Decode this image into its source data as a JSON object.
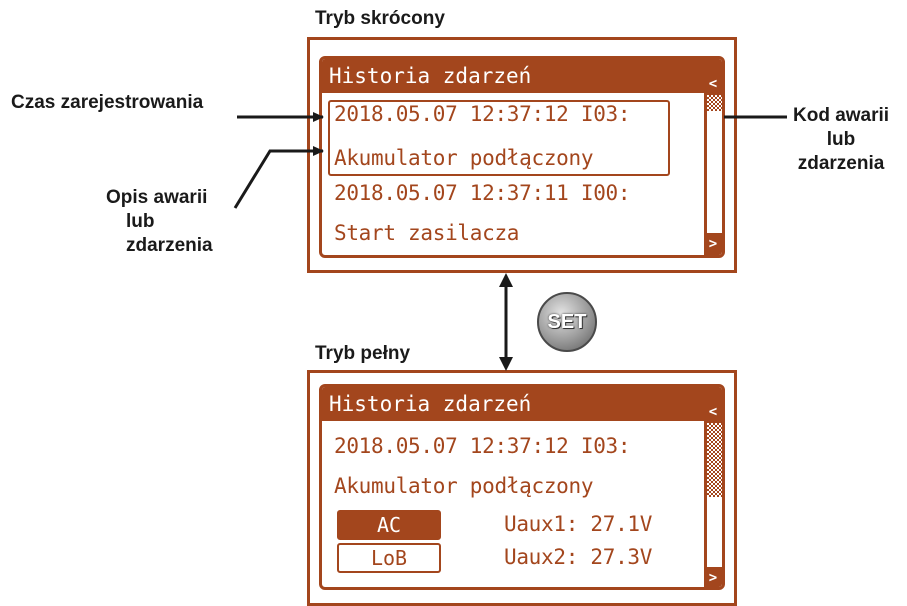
{
  "labels": {
    "short_mode": "Tryb skrócony",
    "full_mode": "Tryb pełny",
    "registration_time": "Czas zarejestrowania",
    "fault_description": [
      "Opis awarii",
      "lub",
      "zdarzenia"
    ],
    "fault_code": [
      "Kod awarii",
      "lub",
      "zdarzenia"
    ]
  },
  "short_screen": {
    "title": "Historia zdarzeń",
    "lines": [
      "2018.05.07 12:37:12 I03:",
      "Akumulator podłączony",
      "2018.05.07 12:37:11 I00:",
      "Start zasilacza"
    ]
  },
  "full_screen": {
    "title": "Historia zdarzeń",
    "lines": [
      "2018.05.07 12:37:12 I03:",
      "Akumulator podłączony"
    ],
    "tag_ac": "AC",
    "tag_lob": "LoB",
    "uaux1": "Uaux1: 27.1V",
    "uaux2": "Uaux2: 27.3V"
  },
  "set_button": "SET",
  "scroll_up": "<",
  "scroll_down": ">",
  "colors": {
    "accent": "#a3461d",
    "text": "#1a1a1a"
  }
}
